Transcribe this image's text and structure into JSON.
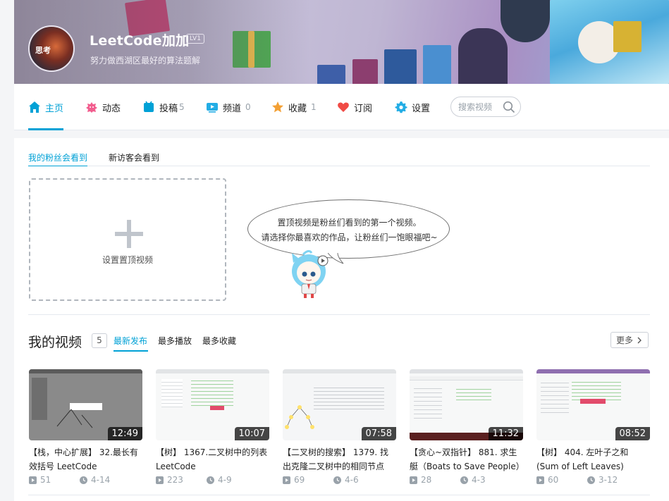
{
  "profile": {
    "username": "LeetCode加加",
    "level": "LV1",
    "signature": "努力做西湖区最好的算法题解",
    "avatar_label": "思考"
  },
  "nav": {
    "home": "主页",
    "dynamic": "动态",
    "posts": "投稿",
    "posts_count": "5",
    "channel": "频道",
    "channel_count": "0",
    "favorites": "收藏",
    "favorites_count": "1",
    "subscribe": "订阅",
    "settings": "设置",
    "search_placeholder": "搜索视频"
  },
  "pinned": {
    "tab_fans": "我的粉丝会看到",
    "tab_visitors": "新访客会看到",
    "upload_label": "设置置顶视频",
    "bubble_line1": "置顶视频是粉丝们看到的第一个视频。",
    "bubble_line2": "请选择你最喜欢的作品，让粉丝们一饱眼福吧~"
  },
  "videos": {
    "section_title": "我的视频",
    "count": "5",
    "sort_latest": "最新发布",
    "sort_plays": "最多播放",
    "sort_favorites": "最多收藏",
    "more": "更多",
    "items": [
      {
        "title": "【栈，中心扩展】 32.最长有效括号 LeetCode",
        "duration": "12:49",
        "plays": "51",
        "date": "4-14"
      },
      {
        "title": "【树】 1367.二叉树中的列表 LeetCode",
        "duration": "10:07",
        "plays": "223",
        "date": "4-9"
      },
      {
        "title": "【二叉树的搜索】 1379. 找出克隆二叉树中的相同节点",
        "duration": "07:58",
        "plays": "69",
        "date": "4-6"
      },
      {
        "title": "【贪心~双指针】 881. 求生艇（Boats to Save People）",
        "duration": "11:32",
        "plays": "28",
        "date": "4-3"
      },
      {
        "title": "【树】 404. 左叶子之和 (Sum of Left Leaves)",
        "duration": "08:52",
        "plays": "60",
        "date": "3-12"
      }
    ]
  },
  "colors": {
    "accent": "#00a1d6",
    "text": "#222222",
    "muted": "#99a2aa",
    "border": "#e5e9ef"
  }
}
